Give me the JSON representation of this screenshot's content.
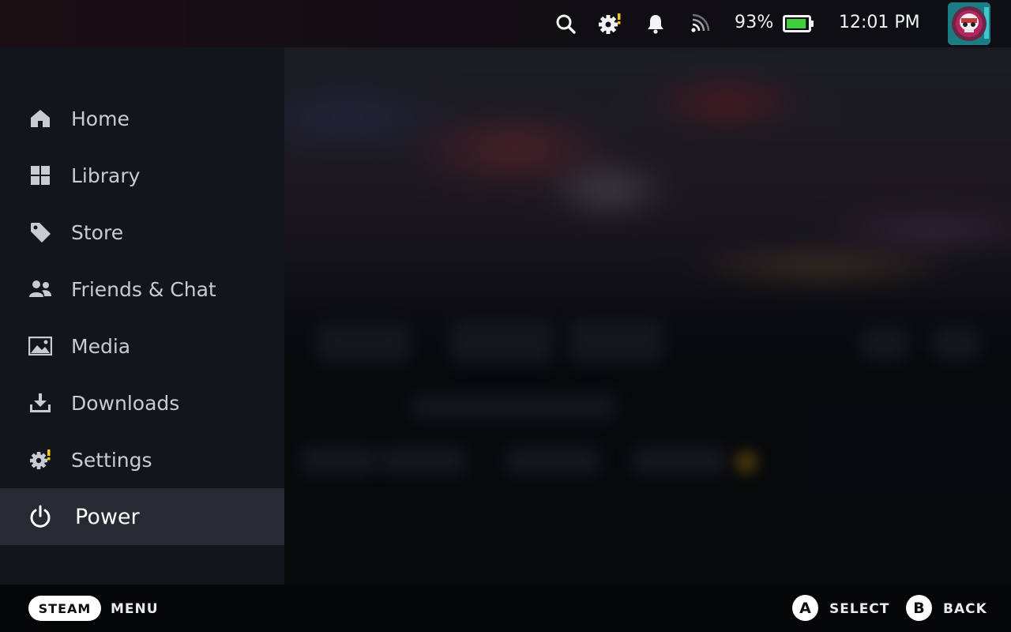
{
  "status_bar": {
    "battery_percent": "93%",
    "battery_level": 0.93,
    "clock": "12:01 PM",
    "icons": [
      "search-icon",
      "settings-alert-icon",
      "notification-bell-icon",
      "wifi-signal-icon",
      "battery-icon"
    ],
    "accent_colors": {
      "battery": "#3fcc3f",
      "alert": "#f5c518",
      "avatar": "#1a7f86"
    }
  },
  "sidebar": {
    "items": [
      {
        "label": "Home",
        "icon": "home-icon"
      },
      {
        "label": "Library",
        "icon": "library-grid-icon"
      },
      {
        "label": "Store",
        "icon": "store-tag-icon"
      },
      {
        "label": "Friends & Chat",
        "icon": "friends-icon"
      },
      {
        "label": "Media",
        "icon": "media-image-icon"
      },
      {
        "label": "Downloads",
        "icon": "download-icon"
      },
      {
        "label": "Settings",
        "icon": "settings-alert-icon"
      },
      {
        "label": "Power",
        "icon": "power-icon",
        "selected": true
      }
    ]
  },
  "bottom_bar": {
    "steam_button": "STEAM",
    "menu_label": "MENU",
    "a_button": "A",
    "select_label": "SELECT",
    "b_button": "B",
    "back_label": "BACK"
  }
}
